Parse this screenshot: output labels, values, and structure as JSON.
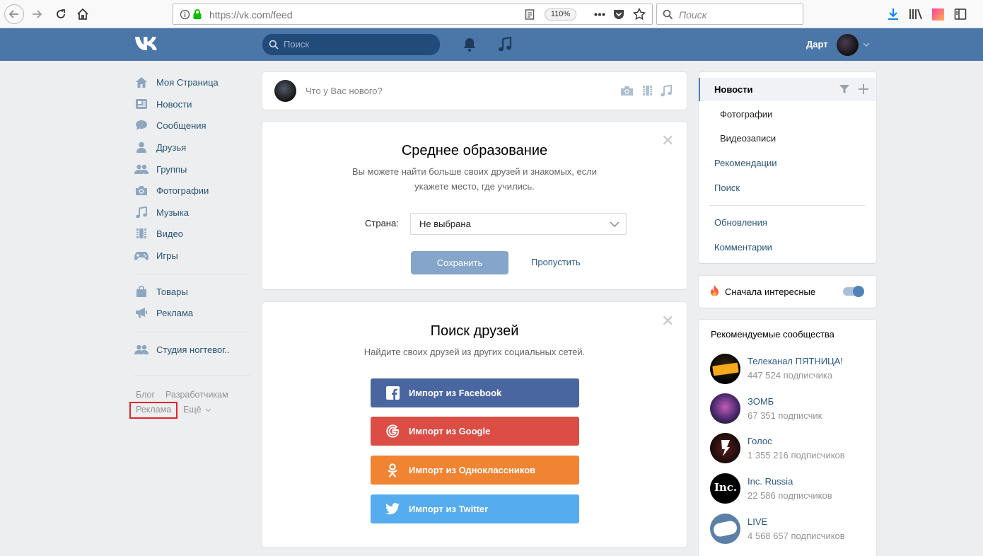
{
  "browser": {
    "url": "https://vk.com/feed",
    "zoom": "110%",
    "search_placeholder": "Поиск"
  },
  "header": {
    "search_placeholder": "Поиск",
    "username": "Дарт"
  },
  "left_menu": {
    "items": [
      {
        "label": "Моя Страница",
        "icon": "home-icon"
      },
      {
        "label": "Новости",
        "icon": "news-icon"
      },
      {
        "label": "Сообщения",
        "icon": "messages-icon"
      },
      {
        "label": "Друзья",
        "icon": "friends-icon"
      },
      {
        "label": "Группы",
        "icon": "groups-icon"
      },
      {
        "label": "Фотографии",
        "icon": "camera-icon"
      },
      {
        "label": "Музыка",
        "icon": "music-icon"
      },
      {
        "label": "Видео",
        "icon": "video-icon"
      },
      {
        "label": "Игры",
        "icon": "games-icon"
      },
      {
        "label": "Товары",
        "icon": "bag-icon"
      },
      {
        "label": "Реклама",
        "icon": "megaphone-icon"
      },
      {
        "label": "Студия ногтевог..",
        "icon": "group-icon"
      }
    ],
    "footer": {
      "blog": "Блог",
      "developers": "Разработчикам",
      "ads": "Реклама",
      "more": "Ещё"
    }
  },
  "post_box": {
    "placeholder": "Что у Вас нового?"
  },
  "education_card": {
    "title": "Среднее образование",
    "text_line1": "Вы можете найти больше своих друзей и знакомых, если",
    "text_line2": "укажете место, где учились.",
    "country_label": "Страна:",
    "country_value": "Не выбрана",
    "save_label": "Сохранить",
    "skip_label": "Пропустить"
  },
  "friends_card": {
    "title": "Поиск друзей",
    "subtitle": "Найдите своих друзей из других социальных сетей.",
    "buttons": [
      {
        "label": "Импорт из Facebook",
        "color": "#4a66a1",
        "icon": "facebook-icon"
      },
      {
        "label": "Импорт из Google",
        "color": "#dc4d45",
        "icon": "google-icon"
      },
      {
        "label": "Импорт из Одноклассников",
        "color": "#f08432",
        "icon": "odnoklassniki-icon"
      },
      {
        "label": "Импорт из Twitter",
        "color": "#55acee",
        "icon": "twitter-icon"
      }
    ]
  },
  "right_menu": {
    "news": "Новости",
    "photos": "Фотографии",
    "videos": "Видеозаписи",
    "recommendations": "Рекомендации",
    "search": "Поиск",
    "updates": "Обновления",
    "comments": "Комментарии"
  },
  "interesting_first": {
    "label": "Сначала интересные",
    "enabled": true
  },
  "recommended": {
    "title": "Рекомендуемые сообщества",
    "items": [
      {
        "name": "Телеканал ПЯТНИЦА!",
        "subs": "447 524 подписчика"
      },
      {
        "name": "ЗОМБ",
        "subs": "67 351 подписчик"
      },
      {
        "name": "Голос",
        "subs": "1 355 216 подписчиков"
      },
      {
        "name": "Inc. Russia",
        "subs": "22 586 подписчиков"
      },
      {
        "name": "LIVE",
        "subs": "4 568 657 подписчиков"
      }
    ]
  },
  "colors": {
    "vk_blue": "#4a76a8",
    "highlight_box": "#e0262c"
  }
}
